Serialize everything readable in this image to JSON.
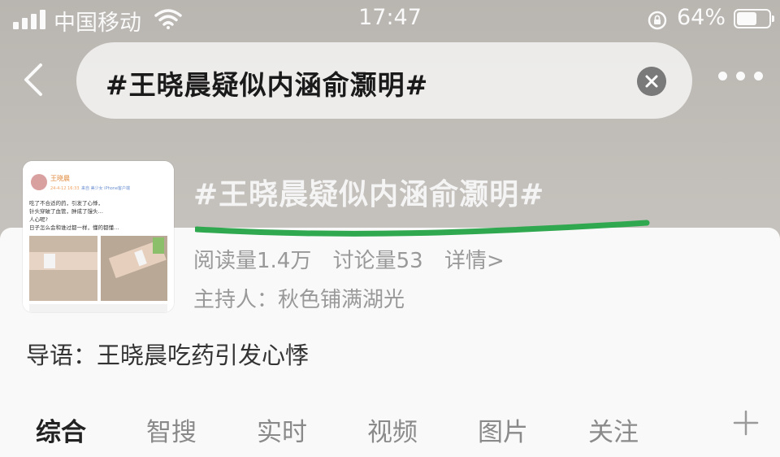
{
  "status_bar": {
    "carrier": "中国移动",
    "time": "17:47",
    "battery_percent": "64%",
    "battery_level": 0.64,
    "icons": [
      "signal-icon",
      "wifi-icon",
      "rotation-lock-icon",
      "battery-icon"
    ]
  },
  "search": {
    "query": "#王晓晨疑似内涵俞灏明#"
  },
  "topic": {
    "title": "#王晓晨疑似内涵俞灏明#",
    "read_count": "阅读量1.4万",
    "discuss_count": "讨论量53",
    "details_link": "详情>",
    "host": "主持人：秋色铺满湖光",
    "guide": "导语：王晓晨吃药引发心悸",
    "underline_color": "#2fa84f"
  },
  "thumbnail": {
    "user": "王晓晨",
    "date": "24-4-12 16:33",
    "source": "来自 美少女 iPhone客户端",
    "post_lines": [
      "吃了不合适的药，引发了心悸，",
      "针头穿破了血管，肿成了馒头…",
      "人心呢?",
      "日子怎么会和谁过都一样，懂的都懂…"
    ]
  },
  "tabs": [
    {
      "label": "综合",
      "active": true
    },
    {
      "label": "智搜",
      "active": false
    },
    {
      "label": "实时",
      "active": false
    },
    {
      "label": "视频",
      "active": false
    },
    {
      "label": "图片",
      "active": false
    },
    {
      "label": "关注",
      "active": false
    }
  ]
}
